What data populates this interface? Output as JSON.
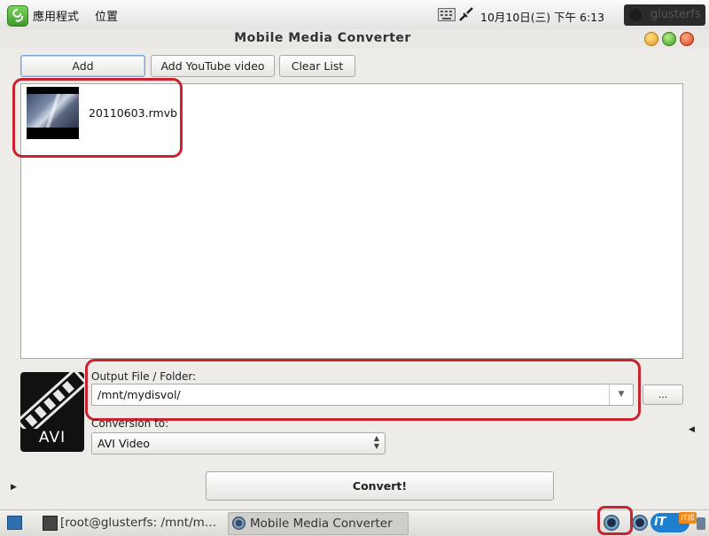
{
  "top_panel": {
    "menu_applications": "應用程式",
    "menu_places": "位置",
    "clock": "10月10日(三) 下午  6:13",
    "user": "glusterfs",
    "icons": [
      "app-logo-icon",
      "keyboard-icon",
      "network-icon"
    ]
  },
  "window": {
    "title": "Mobile Media Converter"
  },
  "toolbar": {
    "add_label": "Add",
    "add_youtube_label": "Add YouTube video",
    "clear_list_label": "Clear List"
  },
  "file_list": {
    "items": [
      {
        "name": "20110603.rmvb"
      }
    ]
  },
  "output": {
    "label": "Output File / Folder:",
    "value": "/mnt/mydisvol/",
    "browse_label": "..."
  },
  "conversion": {
    "label": "Conversion to:",
    "value": "AVI Video",
    "format_icon_text": "AVI"
  },
  "convert_label": "Convert!",
  "taskbar": {
    "tasks": [
      {
        "label": "[root@glusterfs: /mnt/m…"
      },
      {
        "label": "Mobile Media Converter"
      }
    ],
    "tray_badge": "iT邦"
  },
  "colors": {
    "highlight": "#c8232e",
    "title_bg": "#e9e8e4",
    "list_bg": "#ffffff"
  }
}
